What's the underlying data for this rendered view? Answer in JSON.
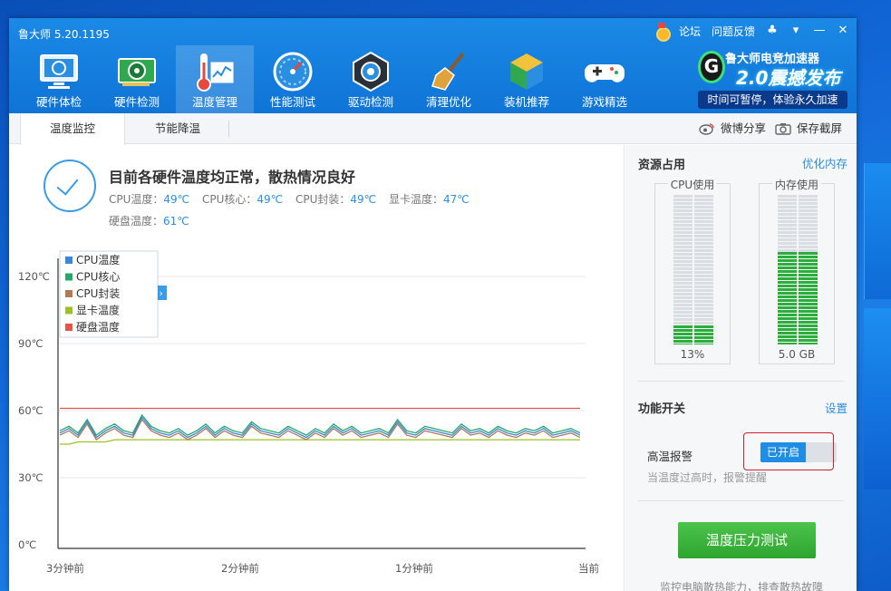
{
  "app": {
    "title": "鲁大师 5.20.1195",
    "links": {
      "forum": "论坛",
      "feedback": "问题反馈"
    }
  },
  "nav": [
    {
      "label": "硬件体检",
      "icon": "monitor-icon"
    },
    {
      "label": "硬件检测",
      "icon": "gpu-card-icon"
    },
    {
      "label": "温度管理",
      "icon": "thermometer-icon"
    },
    {
      "label": "性能测试",
      "icon": "speedometer-icon"
    },
    {
      "label": "驱动检测",
      "icon": "driver-gear-icon"
    },
    {
      "label": "清理优化",
      "icon": "broom-icon"
    },
    {
      "label": "装机推荐",
      "icon": "cube-icon"
    },
    {
      "label": "游戏精选",
      "icon": "gamepad-icon"
    }
  ],
  "promo": {
    "line1": "鲁大师电竞加速器",
    "line2": "2.0震撼发布",
    "line3": "时间可暂停，体验永久加速"
  },
  "subtabs": {
    "monitor": "温度监控",
    "cooling": "节能降温"
  },
  "share": "微博分享",
  "screenshot": "保存截屏",
  "status": {
    "title": "目前各硬件温度均正常，散热情况良好",
    "items": [
      {
        "label": "CPU温度：",
        "value": "49℃"
      },
      {
        "label": "CPU核心：",
        "value": "49℃"
      },
      {
        "label": "CPU封装：",
        "value": "49℃"
      },
      {
        "label": "显卡温度：",
        "value": "47℃"
      },
      {
        "label": "硬盘温度：",
        "value": "61℃"
      }
    ]
  },
  "chart_data": {
    "type": "line",
    "x": [
      "3分钟前",
      "2分钟前",
      "1分钟前",
      "当前"
    ],
    "ylim": [
      0,
      120
    ],
    "yticks": [
      "0℃",
      "30℃",
      "60℃",
      "90℃",
      "120℃"
    ],
    "grid": true,
    "legend_position": "top-left",
    "series": [
      {
        "name": "CPU温度",
        "color": "#3a86d8",
        "values": [
          50,
          52,
          49,
          55,
          48,
          51,
          53,
          50,
          49,
          57,
          52,
          50,
          49,
          51,
          48,
          50,
          53,
          49,
          52,
          50,
          49,
          54,
          51,
          50,
          49,
          52,
          50,
          48,
          51,
          49,
          53,
          50,
          52,
          49,
          50,
          51,
          49,
          55,
          50,
          49,
          52,
          51,
          50,
          49,
          53,
          50,
          51,
          49,
          52,
          50,
          49,
          51,
          50,
          52,
          49,
          50,
          51,
          49
        ]
      },
      {
        "name": "CPU核心",
        "color": "#27a66a",
        "values": [
          51,
          53,
          50,
          56,
          49,
          52,
          54,
          51,
          50,
          58,
          53,
          51,
          50,
          52,
          49,
          51,
          54,
          50,
          53,
          51,
          50,
          55,
          52,
          51,
          50,
          53,
          51,
          49,
          52,
          50,
          54,
          51,
          53,
          50,
          51,
          52,
          50,
          56,
          51,
          50,
          53,
          52,
          51,
          50,
          54,
          51,
          52,
          50,
          53,
          51,
          50,
          52,
          51,
          53,
          50,
          51,
          52,
          50
        ]
      },
      {
        "name": "CPU封装",
        "color": "#b07a55",
        "values": [
          49,
          51,
          48,
          54,
          47,
          50,
          52,
          49,
          48,
          56,
          51,
          49,
          48,
          50,
          47,
          49,
          52,
          48,
          51,
          49,
          48,
          53,
          50,
          49,
          48,
          51,
          49,
          47,
          50,
          48,
          52,
          49,
          51,
          48,
          49,
          50,
          48,
          54,
          49,
          48,
          51,
          50,
          49,
          48,
          52,
          49,
          50,
          48,
          51,
          49,
          48,
          50,
          49,
          51,
          48,
          49,
          50,
          48
        ]
      },
      {
        "name": "显卡温度",
        "color": "#9cc22a",
        "values": [
          45,
          45,
          46,
          46,
          46,
          46,
          47,
          47,
          47,
          47,
          47,
          47,
          47,
          47,
          47,
          47,
          47,
          47,
          47,
          47,
          47,
          47,
          47,
          47,
          47,
          47,
          47,
          47,
          47,
          47,
          47,
          47,
          47,
          47,
          47,
          47,
          47,
          47,
          47,
          47,
          47,
          47,
          47,
          47,
          47,
          47,
          47,
          47,
          47,
          47,
          47,
          47,
          47,
          47,
          47,
          47,
          47,
          47
        ]
      },
      {
        "name": "硬盘温度",
        "color": "#e6534a",
        "values": [
          61,
          61,
          61,
          61,
          61,
          61,
          61,
          61,
          61,
          61,
          61,
          61,
          61,
          61,
          61,
          61,
          61,
          61,
          61,
          61,
          61,
          61,
          61,
          61,
          61,
          61,
          61,
          61,
          61,
          61,
          61,
          61,
          61,
          61,
          61,
          61,
          61,
          61,
          61,
          61,
          61,
          61,
          61,
          61,
          61,
          61,
          61,
          61,
          61,
          61,
          61,
          61,
          61,
          61,
          61,
          61,
          61,
          61
        ]
      }
    ]
  },
  "side": {
    "resources_title": "资源占用",
    "optimize_memory": "优化内存",
    "cpu": {
      "label": "CPU使用",
      "value": "13%",
      "fraction": 0.13
    },
    "mem": {
      "label": "内存使用",
      "value": "5.0 GB",
      "fraction": 0.62
    },
    "features_title": "功能开关",
    "settings": "设置",
    "alarm_label": "高温报警",
    "alarm_state": "已开启",
    "alarm_note": "当温度过高时，报警提醒",
    "stress_button": "温度压力测试",
    "stress_note": "监控电脑散热能力，排查散热故障"
  }
}
